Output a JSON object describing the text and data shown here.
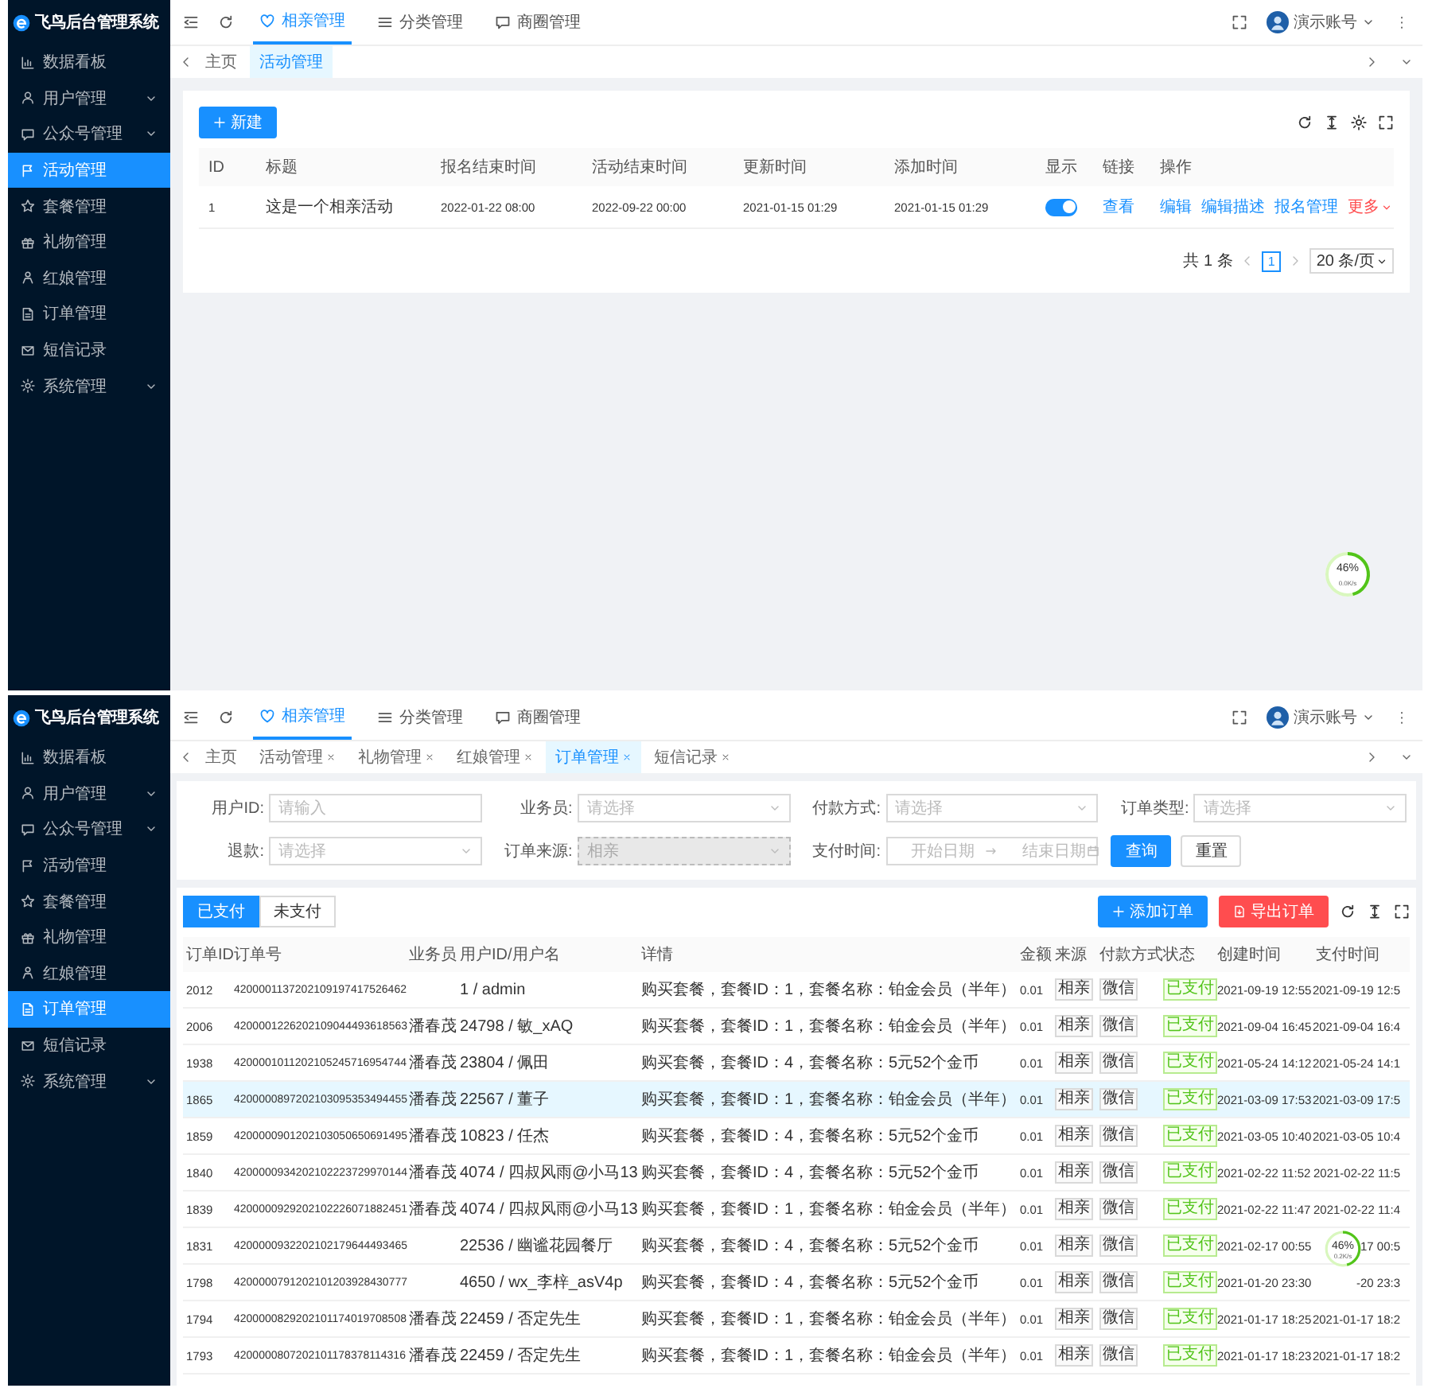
{
  "panels": [
    {
      "sidebar": {
        "title": "飞鸟后台管理系统",
        "items": [
          {
            "label": "数据看板",
            "selected": false,
            "expandable": false
          },
          {
            "label": "用户管理",
            "selected": false,
            "expandable": true
          },
          {
            "label": "公众号管理",
            "selected": false,
            "expandable": true
          },
          {
            "label": "活动管理",
            "selected": true,
            "expandable": false
          },
          {
            "label": "套餐管理",
            "selected": false,
            "expandable": false
          },
          {
            "label": "礼物管理",
            "selected": false,
            "expandable": false
          },
          {
            "label": "红娘管理",
            "selected": false,
            "expandable": false
          },
          {
            "label": "订单管理",
            "selected": false,
            "expandable": false
          },
          {
            "label": "短信记录",
            "selected": false,
            "expandable": false
          },
          {
            "label": "系统管理",
            "selected": false,
            "expandable": true
          }
        ]
      },
      "header": {
        "tabs": [
          {
            "label": "相亲管理",
            "selected": true
          },
          {
            "label": "分类管理",
            "selected": false
          },
          {
            "label": "商圈管理",
            "selected": false
          }
        ],
        "user": "演示账号"
      },
      "page_tabs": [
        {
          "label": "主页",
          "selected": false,
          "closable": false
        },
        {
          "label": "活动管理",
          "selected": true,
          "closable": false
        }
      ],
      "content": {
        "kind": "activity_list",
        "new_button": "新建",
        "columns": [
          "ID",
          "标题",
          "报名结束时间",
          "活动结束时间",
          "更新时间",
          "添加时间",
          "显示",
          "链接",
          "操作"
        ],
        "rows": [
          {
            "id": "1",
            "title": "这是一个相亲活动",
            "signup_end": "2022-01-22 08:00",
            "activity_end": "2022-09-22 00:00",
            "updated": "2021-01-15 01:29",
            "added": "2021-01-15 01:29",
            "shown": true,
            "link": "查看",
            "actions": [
              "编辑",
              "编辑描述",
              "报名管理"
            ],
            "more": "更多"
          }
        ],
        "pagination": {
          "total": "共 1 条",
          "pages": [
            {
              "label": "1",
              "selected": true
            }
          ],
          "page_size": "20 条/页"
        }
      },
      "progress": {
        "percent": "46%",
        "speed": "0.0K/s",
        "level": 0.46
      }
    },
    {
      "sidebar": {
        "title": "飞鸟后台管理系统",
        "items": [
          {
            "label": "数据看板",
            "selected": false,
            "expandable": false
          },
          {
            "label": "用户管理",
            "selected": false,
            "expandable": true
          },
          {
            "label": "公众号管理",
            "selected": false,
            "expandable": true
          },
          {
            "label": "活动管理",
            "selected": false,
            "expandable": false
          },
          {
            "label": "套餐管理",
            "selected": false,
            "expandable": false
          },
          {
            "label": "礼物管理",
            "selected": false,
            "expandable": false
          },
          {
            "label": "红娘管理",
            "selected": false,
            "expandable": false
          },
          {
            "label": "订单管理",
            "selected": true,
            "expandable": false
          },
          {
            "label": "短信记录",
            "selected": false,
            "expandable": false
          },
          {
            "label": "系统管理",
            "selected": false,
            "expandable": true
          }
        ]
      },
      "header": {
        "tabs": [
          {
            "label": "相亲管理",
            "selected": true
          },
          {
            "label": "分类管理",
            "selected": false
          },
          {
            "label": "商圈管理",
            "selected": false
          }
        ],
        "user": "演示账号"
      },
      "page_tabs": [
        {
          "label": "主页",
          "selected": false,
          "closable": false
        },
        {
          "label": "活动管理",
          "selected": false,
          "closable": true
        },
        {
          "label": "礼物管理",
          "selected": false,
          "closable": true
        },
        {
          "label": "红娘管理",
          "selected": false,
          "closable": true
        },
        {
          "label": "订单管理",
          "selected": true,
          "closable": true
        },
        {
          "label": "短信记录",
          "selected": false,
          "closable": true
        }
      ],
      "content": {
        "kind": "order_list",
        "filters": [
          {
            "kind": "input",
            "label": "用户ID:",
            "placeholder": "请输入",
            "disabled": false
          },
          {
            "kind": "select",
            "label": "业务员:",
            "placeholder": "请选择",
            "disabled": false
          },
          {
            "kind": "select",
            "label": "付款方式:",
            "placeholder": "请选择",
            "disabled": false
          },
          {
            "kind": "select",
            "label": "订单类型:",
            "placeholder": "请选择",
            "disabled": false
          },
          {
            "kind": "select",
            "label": "退款:",
            "placeholder": "请选择",
            "disabled": false
          },
          {
            "kind": "select",
            "label": "订单来源:",
            "value": "相亲",
            "disabled": true
          },
          {
            "kind": "daterange",
            "label": "支付时间:",
            "start_placeholder": "开始日期",
            "end_placeholder": "结束日期",
            "disabled": false
          }
        ],
        "search_button": "查询",
        "reset_button": "重置",
        "status_tabs": [
          {
            "label": "已支付",
            "selected": true
          },
          {
            "label": "未支付",
            "selected": false
          }
        ],
        "add_button": "添加订单",
        "export_button": "导出订单",
        "columns": [
          "订单ID",
          "订单号",
          "业务员",
          "用户ID/用户名",
          "详情",
          "金额",
          "来源",
          "付款方式",
          "状态",
          "创建时间",
          "支付时间"
        ],
        "rows": [
          {
            "id": "2012",
            "order_no": "4200001137202109197417526462",
            "salesman": "",
            "user": "1 / admin",
            "detail": "购买套餐，套餐ID：1，套餐名称：铂金会员（半年）",
            "amount": "0.01",
            "source": "相亲",
            "payment": "微信",
            "status": "已支付",
            "created": "2021-09-19 12:55",
            "paid": "2021-09-19 12:5",
            "selected": false
          },
          {
            "id": "2006",
            "order_no": "4200001226202109044493618563",
            "salesman": "潘春茂",
            "user": "24798 / 敏_xAQ",
            "detail": "购买套餐，套餐ID：1，套餐名称：铂金会员（半年）",
            "amount": "0.01",
            "source": "相亲",
            "payment": "微信",
            "status": "已支付",
            "created": "2021-09-04 16:45",
            "paid": "2021-09-04 16:4",
            "selected": false
          },
          {
            "id": "1938",
            "order_no": "4200001011202105245716954744",
            "salesman": "潘春茂",
            "user": "23804 / 佩田",
            "detail": "购买套餐，套餐ID：4，套餐名称：5元52个金币",
            "amount": "0.01",
            "source": "相亲",
            "payment": "微信",
            "status": "已支付",
            "created": "2021-05-24 14:12",
            "paid": "2021-05-24 14:1",
            "selected": false
          },
          {
            "id": "1865",
            "order_no": "4200000897202103095353494455",
            "salesman": "潘春茂",
            "user": "22567 / 董子",
            "detail": "购买套餐，套餐ID：1，套餐名称：铂金会员（半年）",
            "amount": "0.01",
            "source": "相亲",
            "payment": "微信",
            "status": "已支付",
            "created": "2021-03-09 17:53",
            "paid": "2021-03-09 17:5",
            "selected": true
          },
          {
            "id": "1859",
            "order_no": "4200000901202103050650691495",
            "salesman": "潘春茂",
            "user": "10823 / 任杰",
            "detail": "购买套餐，套餐ID：4，套餐名称：5元52个金币",
            "amount": "0.01",
            "source": "相亲",
            "payment": "微信",
            "status": "已支付",
            "created": "2021-03-05 10:40",
            "paid": "2021-03-05 10:4",
            "selected": false
          },
          {
            "id": "1840",
            "order_no": "4200000934202102223729970144",
            "salesman": "潘春茂",
            "user": "4074 / 四叔风雨@小马13",
            "detail": "购买套餐，套餐ID：4，套餐名称：5元52个金币",
            "amount": "0.01",
            "source": "相亲",
            "payment": "微信",
            "status": "已支付",
            "created": "2021-02-22 11:52",
            "paid": "2021-02-22 11:5",
            "selected": false
          },
          {
            "id": "1839",
            "order_no": "4200000929202102226071882451",
            "salesman": "潘春茂",
            "user": "4074 / 四叔风雨@小马13",
            "detail": "购买套餐，套餐ID：1，套餐名称：铂金会员（半年）",
            "amount": "0.01",
            "source": "相亲",
            "payment": "微信",
            "status": "已支付",
            "created": "2021-02-22 11:47",
            "paid": "2021-02-22 11:4",
            "selected": false
          },
          {
            "id": "1831",
            "order_no": "4200000932202102179644493465",
            "salesman": "",
            "user": "22536 / 幽谧花园餐厅",
            "detail": "购买套餐，套餐ID：4，套餐名称：5元52个金币",
            "amount": "0.01",
            "source": "相亲",
            "payment": "微信",
            "status": "已支付",
            "created": "2021-02-17 00:55",
            "paid": "17 00:5",
            "selected": false
          },
          {
            "id": "1798",
            "order_no": "4200000791202101203928430777",
            "salesman": "",
            "user": "4650 / wx_李梓_asV4p",
            "detail": "购买套餐，套餐ID：4，套餐名称：5元52个金币",
            "amount": "0.01",
            "source": "相亲",
            "payment": "微信",
            "status": "已支付",
            "created": "2021-01-20 23:30",
            "paid": "-20 23:3",
            "selected": false
          },
          {
            "id": "1794",
            "order_no": "4200000829202101174019708508",
            "salesman": "潘春茂",
            "user": "22459 / 否定先生",
            "detail": "购买套餐，套餐ID：1，套餐名称：铂金会员（半年）",
            "amount": "0.01",
            "source": "相亲",
            "payment": "微信",
            "status": "已支付",
            "created": "2021-01-17 18:25",
            "paid": "2021-01-17 18:2",
            "selected": false
          },
          {
            "id": "1793",
            "order_no": "4200000807202101178378114316",
            "salesman": "潘春茂",
            "user": "22459 / 否定先生",
            "detail": "购买套餐，套餐ID：1，套餐名称：铂金会员（半年）",
            "amount": "0.01",
            "source": "相亲",
            "payment": "微信",
            "status": "已支付",
            "created": "2021-01-17 18:23",
            "paid": "2021-01-17 18:2",
            "selected": false
          }
        ]
      },
      "progress": {
        "percent": "46%",
        "speed": "0.2K/s",
        "level": 0.46
      }
    }
  ]
}
